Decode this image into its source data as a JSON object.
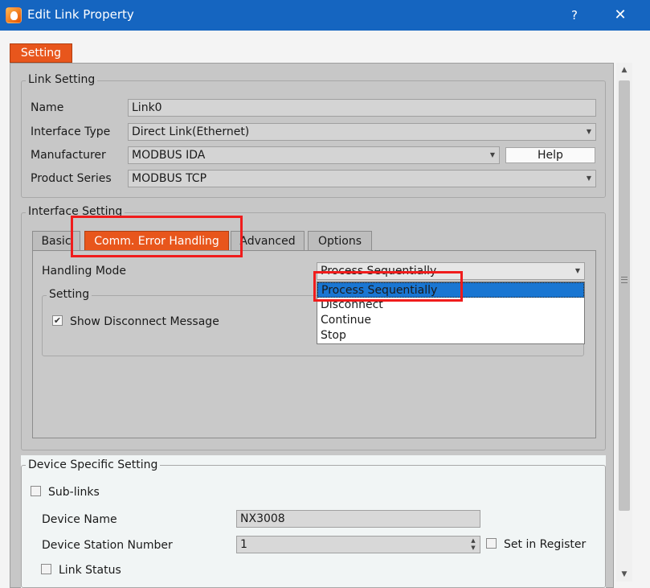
{
  "window": {
    "title": "Edit Link Property",
    "help_glyph": "?",
    "close_glyph": "✕"
  },
  "main_tab": "Setting",
  "link_setting": {
    "title": "Link Setting",
    "name_label": "Name",
    "name_value": "Link0",
    "interface_type_label": "Interface Type",
    "interface_type_value": "Direct Link(Ethernet)",
    "manufacturer_label": "Manufacturer",
    "manufacturer_value": "MODBUS IDA",
    "help_button": "Help",
    "product_series_label": "Product Series",
    "product_series_value": "MODBUS TCP"
  },
  "interface_setting": {
    "title": "Interface Setting",
    "tabs": [
      "Basic",
      "Comm. Error Handling",
      "Advanced",
      "Options"
    ],
    "active_tab": "Comm. Error Handling",
    "handling_mode_label": "Handling Mode",
    "handling_mode_value": "Process Sequentially",
    "handling_mode_options": [
      "Process Sequentially",
      "Disconnect",
      "Continue",
      "Stop"
    ],
    "setting_group_title": "Setting",
    "show_disconnect_label": "Show Disconnect Message",
    "show_disconnect_checked": true
  },
  "device_specific": {
    "title": "Device Specific Setting",
    "sublinks_label": "Sub-links",
    "sublinks_checked": false,
    "device_name_label": "Device Name",
    "device_name_value": "NX3008",
    "station_label": "Device Station Number",
    "station_value": "1",
    "set_in_register_label": "Set in Register",
    "set_in_register_checked": false,
    "link_status_label": "Link Status",
    "link_status_checked": false
  },
  "colors": {
    "titlebar": "#1565c0",
    "accent_tab": "#e8561c",
    "highlight": "#f01c1c",
    "selection": "#1976d2"
  }
}
